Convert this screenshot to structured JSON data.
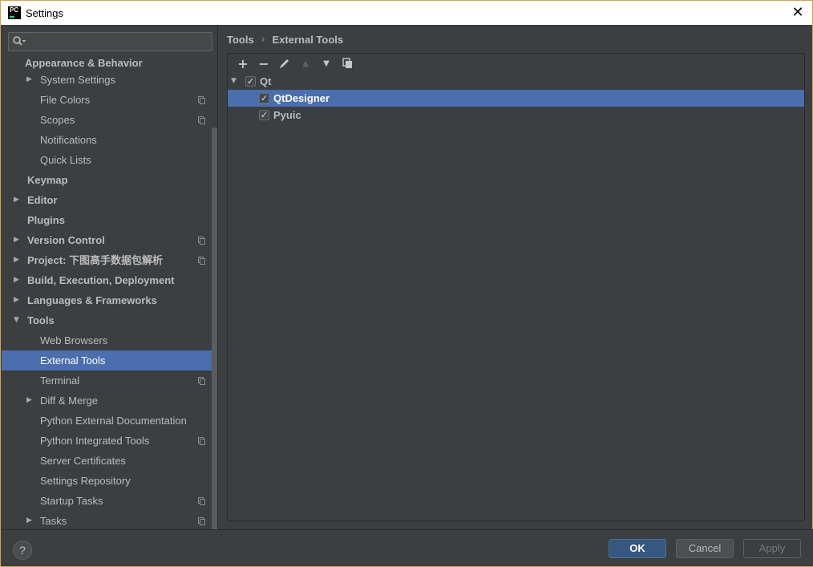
{
  "window": {
    "title": "Settings",
    "app_icon_text": "PC"
  },
  "search": {
    "placeholder": ""
  },
  "sidebar": {
    "items": [
      {
        "label": "Appearance & Behavior",
        "bold": true,
        "level": 0,
        "arrow": "",
        "copy": false
      },
      {
        "label": "System Settings",
        "bold": false,
        "level": 1,
        "arrow": "right",
        "copy": false
      },
      {
        "label": "File Colors",
        "bold": false,
        "level": 1,
        "arrow": "",
        "copy": true
      },
      {
        "label": "Scopes",
        "bold": false,
        "level": 1,
        "arrow": "",
        "copy": true
      },
      {
        "label": "Notifications",
        "bold": false,
        "level": 1,
        "arrow": "",
        "copy": false
      },
      {
        "label": "Quick Lists",
        "bold": false,
        "level": 1,
        "arrow": "",
        "copy": false
      },
      {
        "label": "Keymap",
        "bold": true,
        "level": 0,
        "arrow": "",
        "copy": false
      },
      {
        "label": "Editor",
        "bold": true,
        "level": 0,
        "arrow": "right",
        "copy": false
      },
      {
        "label": "Plugins",
        "bold": true,
        "level": 0,
        "arrow": "",
        "copy": false
      },
      {
        "label": "Version Control",
        "bold": true,
        "level": 0,
        "arrow": "right",
        "copy": true
      },
      {
        "label": "Project: 下图高手数据包解析",
        "bold": true,
        "level": 0,
        "arrow": "right",
        "copy": true
      },
      {
        "label": "Build, Execution, Deployment",
        "bold": true,
        "level": 0,
        "arrow": "right",
        "copy": false
      },
      {
        "label": "Languages & Frameworks",
        "bold": true,
        "level": 0,
        "arrow": "right",
        "copy": false
      },
      {
        "label": "Tools",
        "bold": true,
        "level": 0,
        "arrow": "down",
        "copy": false
      },
      {
        "label": "Web Browsers",
        "bold": false,
        "level": 1,
        "arrow": "",
        "copy": false
      },
      {
        "label": "External Tools",
        "bold": false,
        "level": 1,
        "arrow": "",
        "copy": false,
        "selected": true
      },
      {
        "label": "Terminal",
        "bold": false,
        "level": 1,
        "arrow": "",
        "copy": true
      },
      {
        "label": "Diff & Merge",
        "bold": false,
        "level": 1,
        "arrow": "right",
        "copy": false
      },
      {
        "label": "Python External Documentation",
        "bold": false,
        "level": 1,
        "arrow": "",
        "copy": false
      },
      {
        "label": "Python Integrated Tools",
        "bold": false,
        "level": 1,
        "arrow": "",
        "copy": true
      },
      {
        "label": "Server Certificates",
        "bold": false,
        "level": 1,
        "arrow": "",
        "copy": false
      },
      {
        "label": "Settings Repository",
        "bold": false,
        "level": 1,
        "arrow": "",
        "copy": false
      },
      {
        "label": "Startup Tasks",
        "bold": false,
        "level": 1,
        "arrow": "",
        "copy": true
      },
      {
        "label": "Tasks",
        "bold": false,
        "level": 1,
        "arrow": "right",
        "copy": true
      }
    ]
  },
  "breadcrumb": {
    "parent": "Tools",
    "separator": "›",
    "current": "External Tools"
  },
  "toolbar": {
    "add": "+",
    "remove": "−",
    "edit": "edit-icon",
    "up": "▲",
    "down": "▼",
    "copy": "copy-icon"
  },
  "tools": {
    "group": {
      "label": "Qt",
      "checked": true,
      "expanded": true
    },
    "items": [
      {
        "label": "QtDesigner",
        "checked": true,
        "selected": true
      },
      {
        "label": "Pyuic",
        "checked": true,
        "selected": false
      }
    ]
  },
  "footer": {
    "help": "?",
    "ok": "OK",
    "cancel": "Cancel",
    "apply": "Apply"
  },
  "colors": {
    "selection": "#4b6eaf",
    "panel_bg": "#3c3f41",
    "ok_button": "#365880"
  }
}
